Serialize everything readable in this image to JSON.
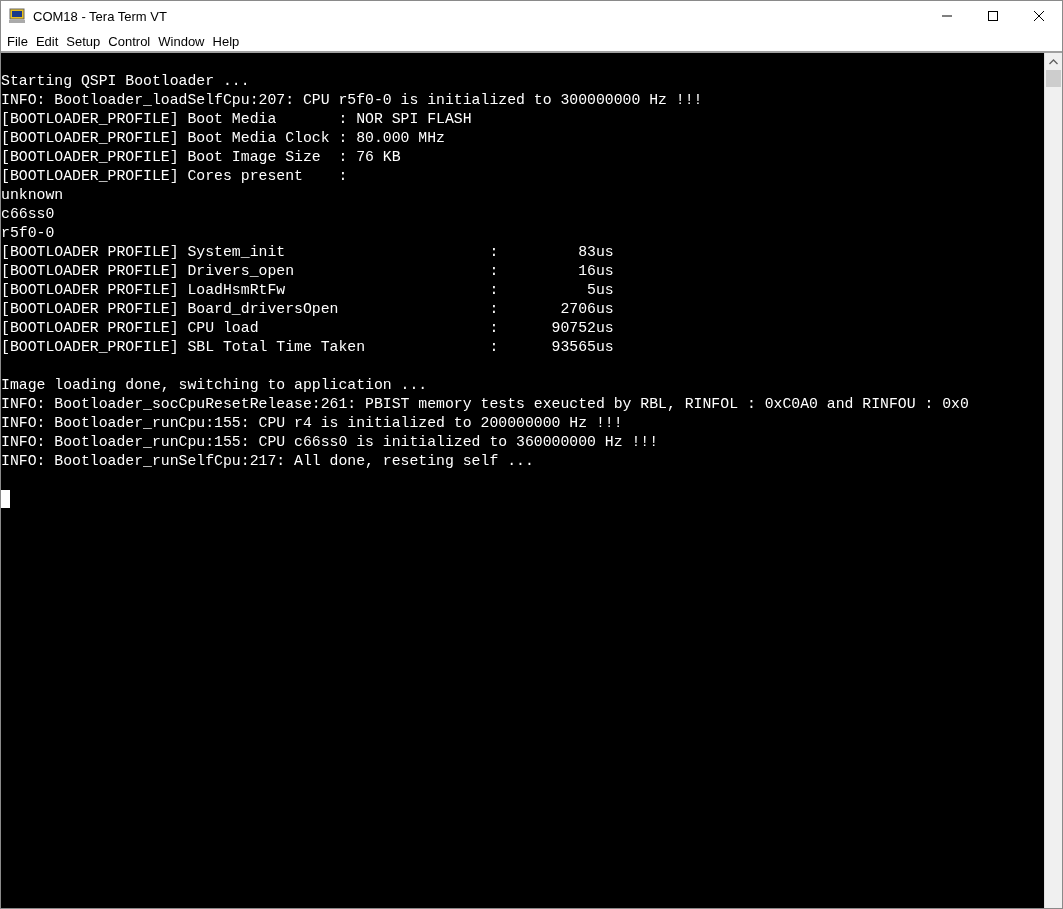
{
  "window": {
    "title": "COM18 - Tera Term VT"
  },
  "menu": [
    {
      "label": "File"
    },
    {
      "label": "Edit"
    },
    {
      "label": "Setup"
    },
    {
      "label": "Control"
    },
    {
      "label": "Window"
    },
    {
      "label": "Help"
    }
  ],
  "terminal": {
    "blocks": [
      [
        "Starting QSPI Bootloader ...",
        "INFO: Bootloader_loadSelfCpu:207: CPU r5f0-0 is initialized to 300000000 Hz !!!",
        "[BOOTLOADER_PROFILE] Boot Media       : NOR SPI FLASH",
        "[BOOTLOADER_PROFILE] Boot Media Clock : 80.000 MHz",
        "[BOOTLOADER_PROFILE] Boot Image Size  : 76 KB",
        "[BOOTLOADER_PROFILE] Cores present    :",
        "unknown",
        "c66ss0",
        "r5f0-0",
        "[BOOTLOADER PROFILE] System_init                       :         83us",
        "[BOOTLOADER PROFILE] Drivers_open                      :         16us",
        "[BOOTLOADER PROFILE] LoadHsmRtFw                       :          5us",
        "[BOOTLOADER PROFILE] Board_driversOpen                 :       2706us",
        "[BOOTLOADER PROFILE] CPU load                          :      90752us",
        "[BOOTLOADER_PROFILE] SBL Total Time Taken              :      93565us"
      ],
      [
        "Image loading done, switching to application ...",
        "INFO: Bootloader_socCpuResetRelease:261: PBIST memory tests exeucted by RBL, RINFOL : 0xC0A0 and RINFOU : 0x0",
        "INFO: Bootloader_runCpu:155: CPU r4 is initialized to 200000000 Hz !!!",
        "INFO: Bootloader_runCpu:155: CPU c66ss0 is initialized to 360000000 Hz !!!",
        "INFO: Bootloader_runSelfCpu:217: All done, reseting self ..."
      ]
    ]
  }
}
